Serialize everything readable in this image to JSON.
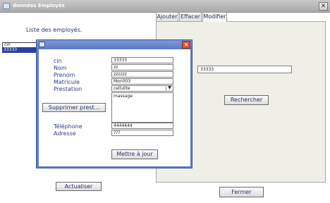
{
  "window": {
    "title": "données Employés",
    "close": "✕"
  },
  "left": {
    "heading": "Liste des employés.",
    "filter_value": "cin",
    "list_items": [
      "33333"
    ],
    "refresh_label": "Actualiser"
  },
  "tabs": [
    "Ajouter",
    "Effacer",
    "Modifier"
  ],
  "modifier": {
    "search_value": "33333",
    "search_label": "Rechercher"
  },
  "close_label": "Fermer",
  "dialog": {
    "close": "✕",
    "fields": {
      "cin": {
        "label": "cin",
        "value": "33333"
      },
      "nom": {
        "label": "Nom",
        "value": "zz"
      },
      "prenom": {
        "label": "Prenom",
        "value": "zzzzzz"
      },
      "matricule": {
        "label": "Matricule",
        "value": "Mon003"
      },
      "prestation": {
        "label": "Prestation",
        "value": "cellulite"
      },
      "telephone": {
        "label": "Téléphone",
        "value": "4444444"
      },
      "adresse": {
        "label": "Adresse",
        "value": "???"
      }
    },
    "prestations_list": [
      "massage"
    ],
    "delete_prest_label": "Supprimer prest...",
    "update_label": "Mettre à jour"
  }
}
